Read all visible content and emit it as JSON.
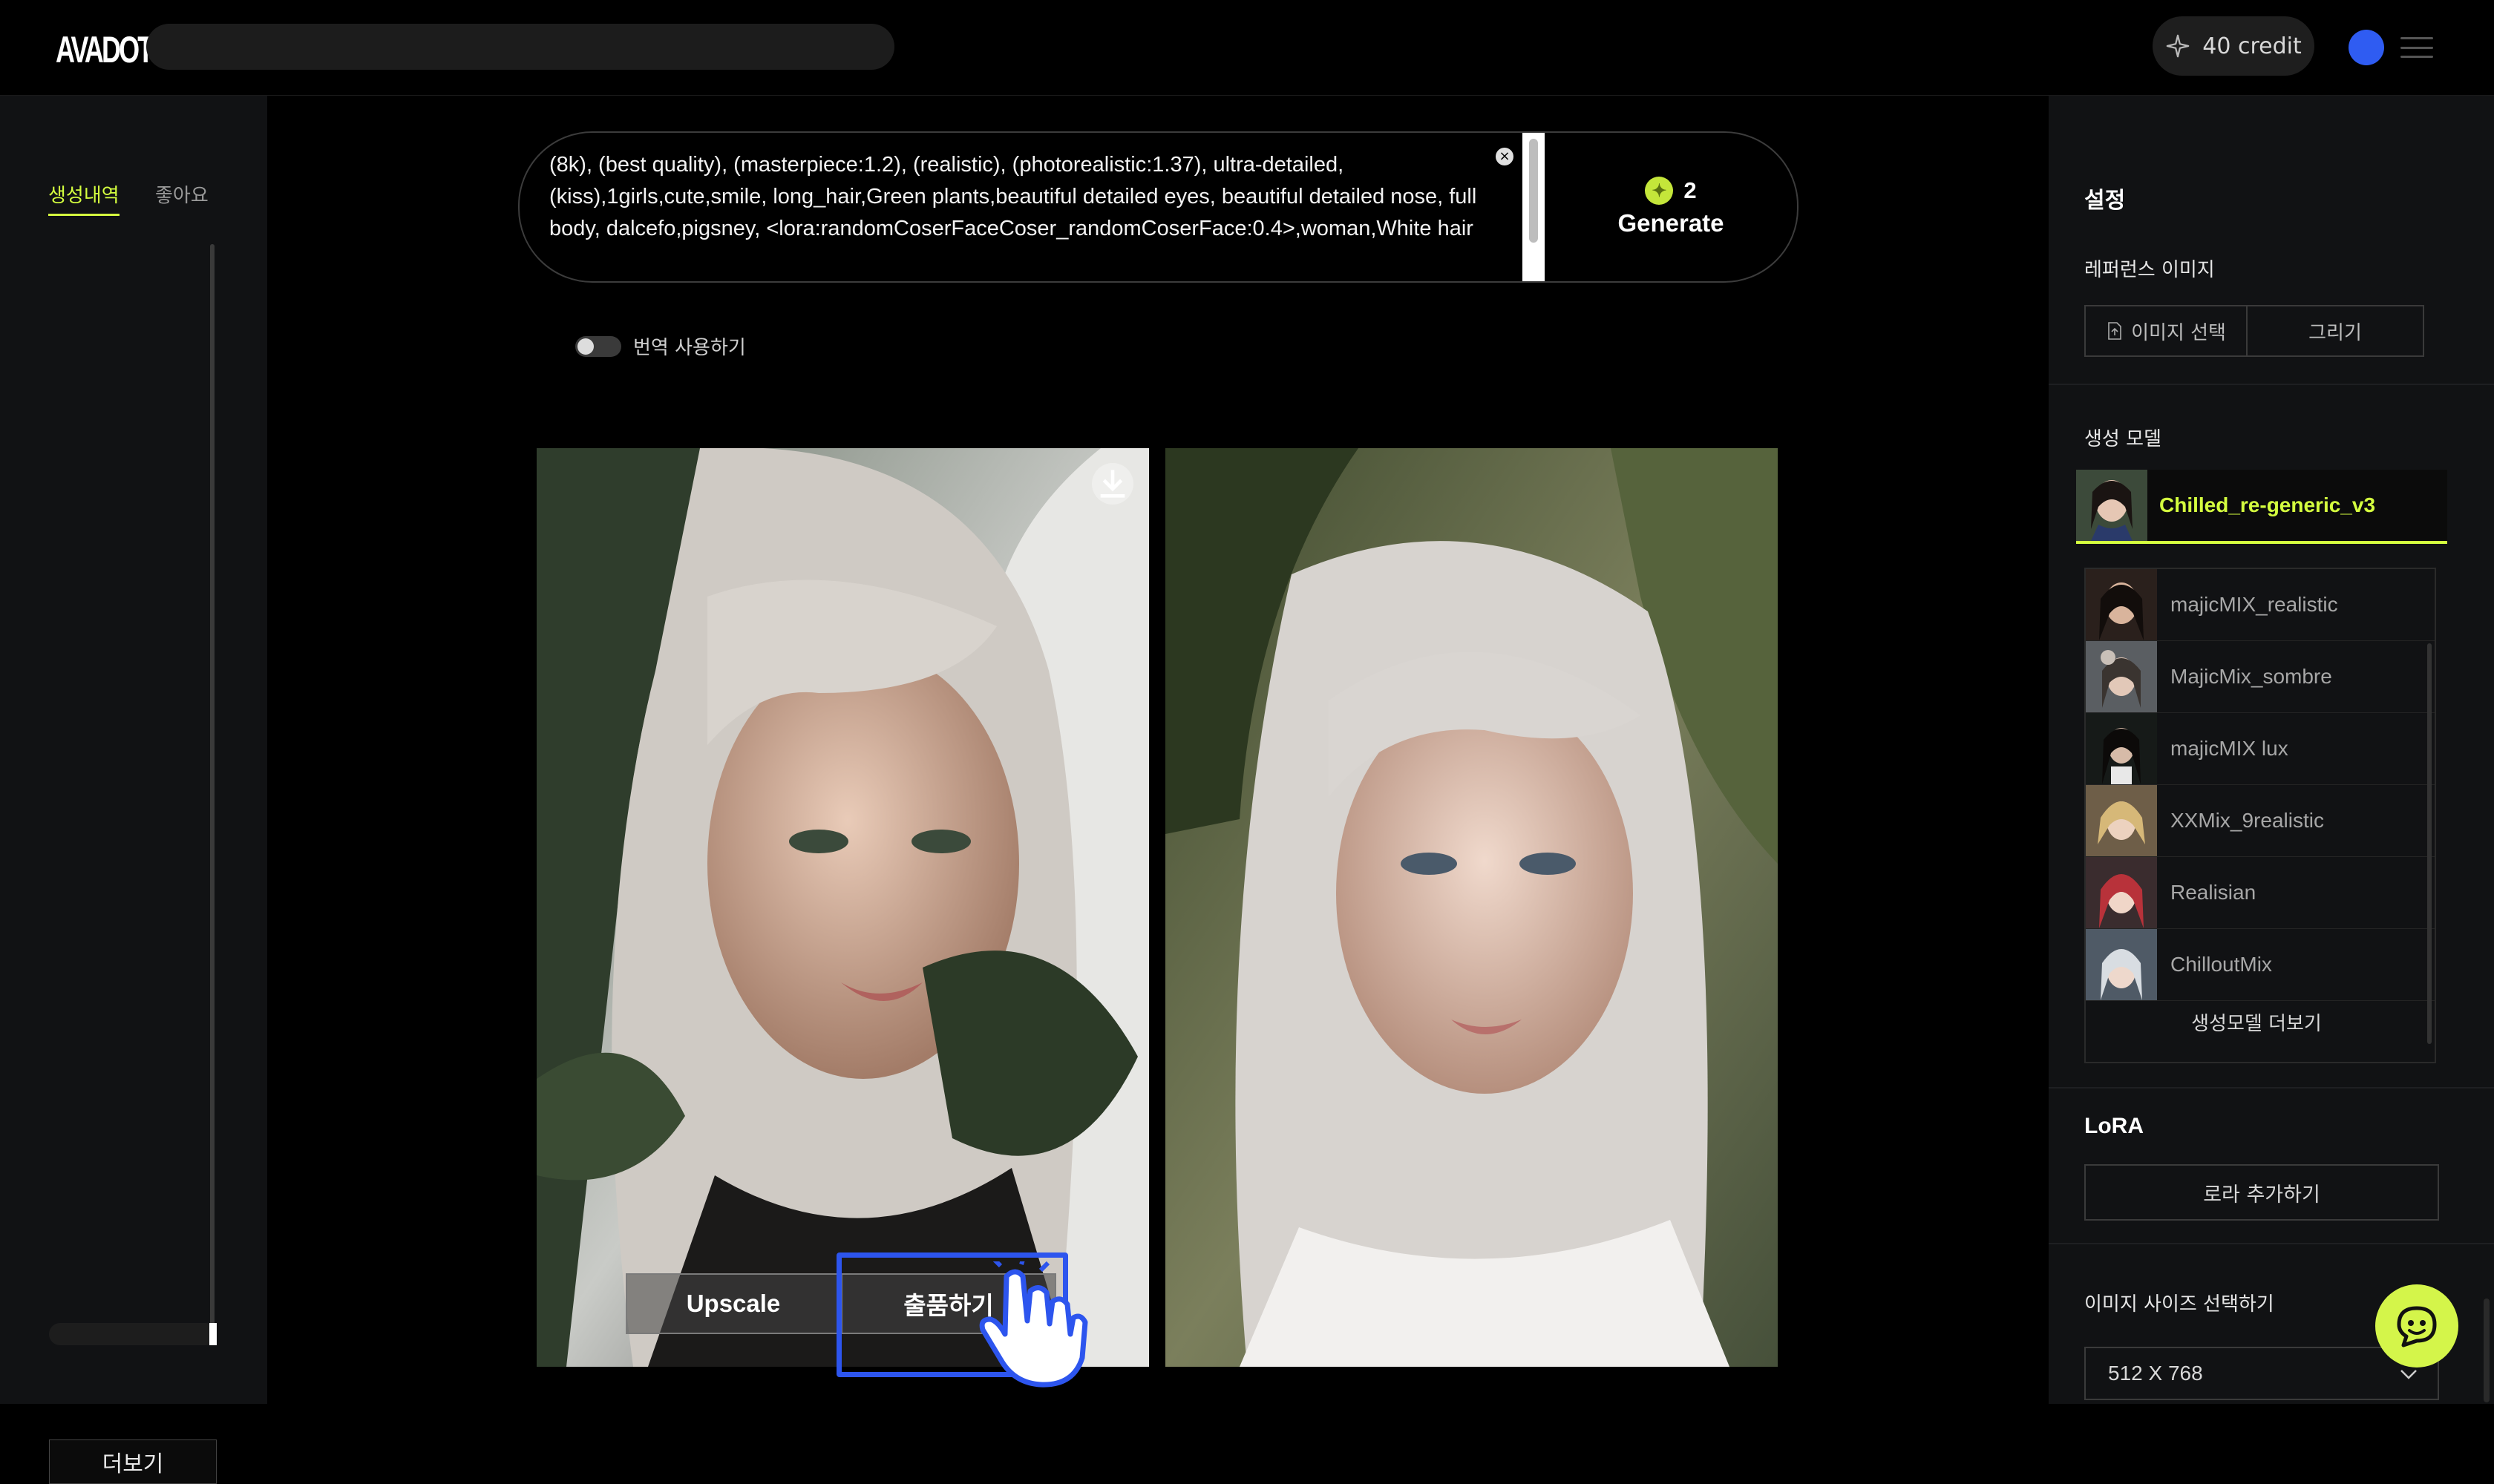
{
  "header": {
    "logo": "AVADOT",
    "credit": "40 credit"
  },
  "left": {
    "tabs": [
      "생성내역",
      "좋아요"
    ],
    "more": "더보기"
  },
  "prompt": {
    "text": "(8k), (best quality), (masterpiece:1.2), (realistic), (photorealistic:1.37), ultra-detailed, (kiss),1girls,cute,smile, long_hair,Green plants,beautiful detailed eyes, beautiful detailed nose, full body, dalcefo,pigsney, <lora:randomCoserFaceCoser_randomCoserFace:0.4>,woman,White hair",
    "cost": "2",
    "generate": "Generate",
    "translate": "번역 사용하기"
  },
  "image_actions": {
    "upscale": "Upscale",
    "sell": "출품하기"
  },
  "settings": {
    "title": "설정",
    "reference_label": "레퍼런스 이미지",
    "select_image": "이미지 선택",
    "draw": "그리기",
    "model_label": "생성 모델",
    "selected_model": "Chilled_re-generic_v3",
    "models": [
      {
        "name": "majicMIX_realistic"
      },
      {
        "name": "MajicMix_sombre"
      },
      {
        "name": "majicMIX lux"
      },
      {
        "name": "XXMix_9realistic"
      },
      {
        "name": "Realisian"
      },
      {
        "name": "ChilloutMix"
      }
    ],
    "more_models": "생성모델 더보기",
    "lora_label": "LoRA",
    "lora_add": "로라 추가하기",
    "size_label": "이미지 사이즈 선택하기",
    "size_value": "512 X 768"
  },
  "colors": {
    "accent": "#d4ff3f",
    "highlight": "#2d55ee",
    "avatar": "#2f5cf2"
  }
}
